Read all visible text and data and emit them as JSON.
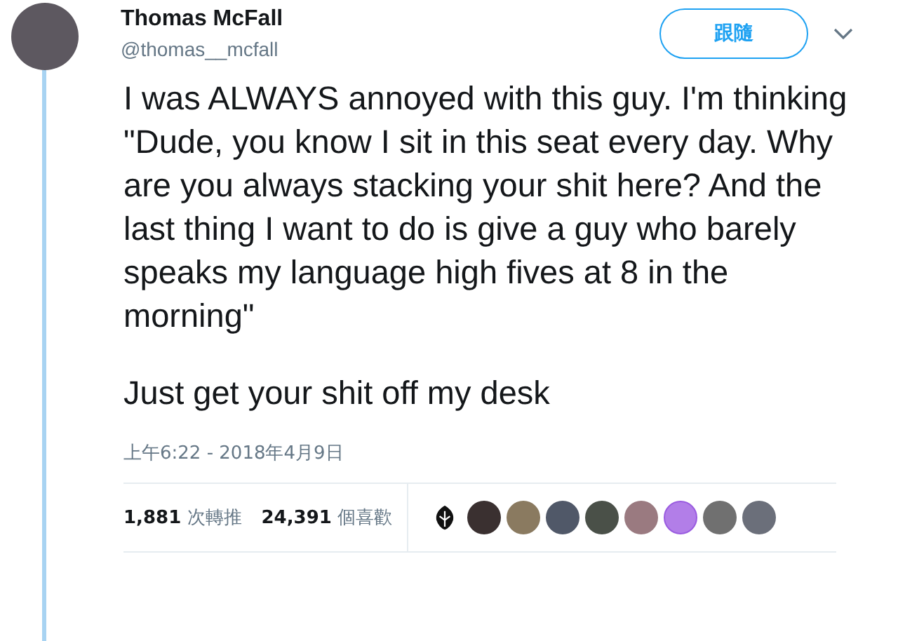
{
  "author": {
    "name": "Thomas McFall",
    "handle": "@thomas__mcfall"
  },
  "follow_button": {
    "label": "跟隨"
  },
  "tweet": {
    "paragraphs": [
      "I was ALWAYS annoyed with this guy. I'm thinking \"Dude, you know I sit in this seat every day. Why are you always stacking your shit here? And the last thing I want to do is give a guy who barely speaks my language high fives at 8 in the morning\"",
      "Just get your shit off my desk"
    ],
    "timestamp": "上午6:22 - 2018年4月9日"
  },
  "stats": [
    {
      "count": "1,881",
      "label": "次轉推"
    },
    {
      "count": "24,391",
      "label": "個喜歡"
    }
  ],
  "likers": [
    {
      "kind": "emblem"
    },
    {
      "kind": "photo"
    },
    {
      "kind": "photo"
    },
    {
      "kind": "photo"
    },
    {
      "kind": "photo"
    },
    {
      "kind": "photo"
    },
    {
      "kind": "cat"
    },
    {
      "kind": "photo"
    },
    {
      "kind": "photo"
    }
  ]
}
